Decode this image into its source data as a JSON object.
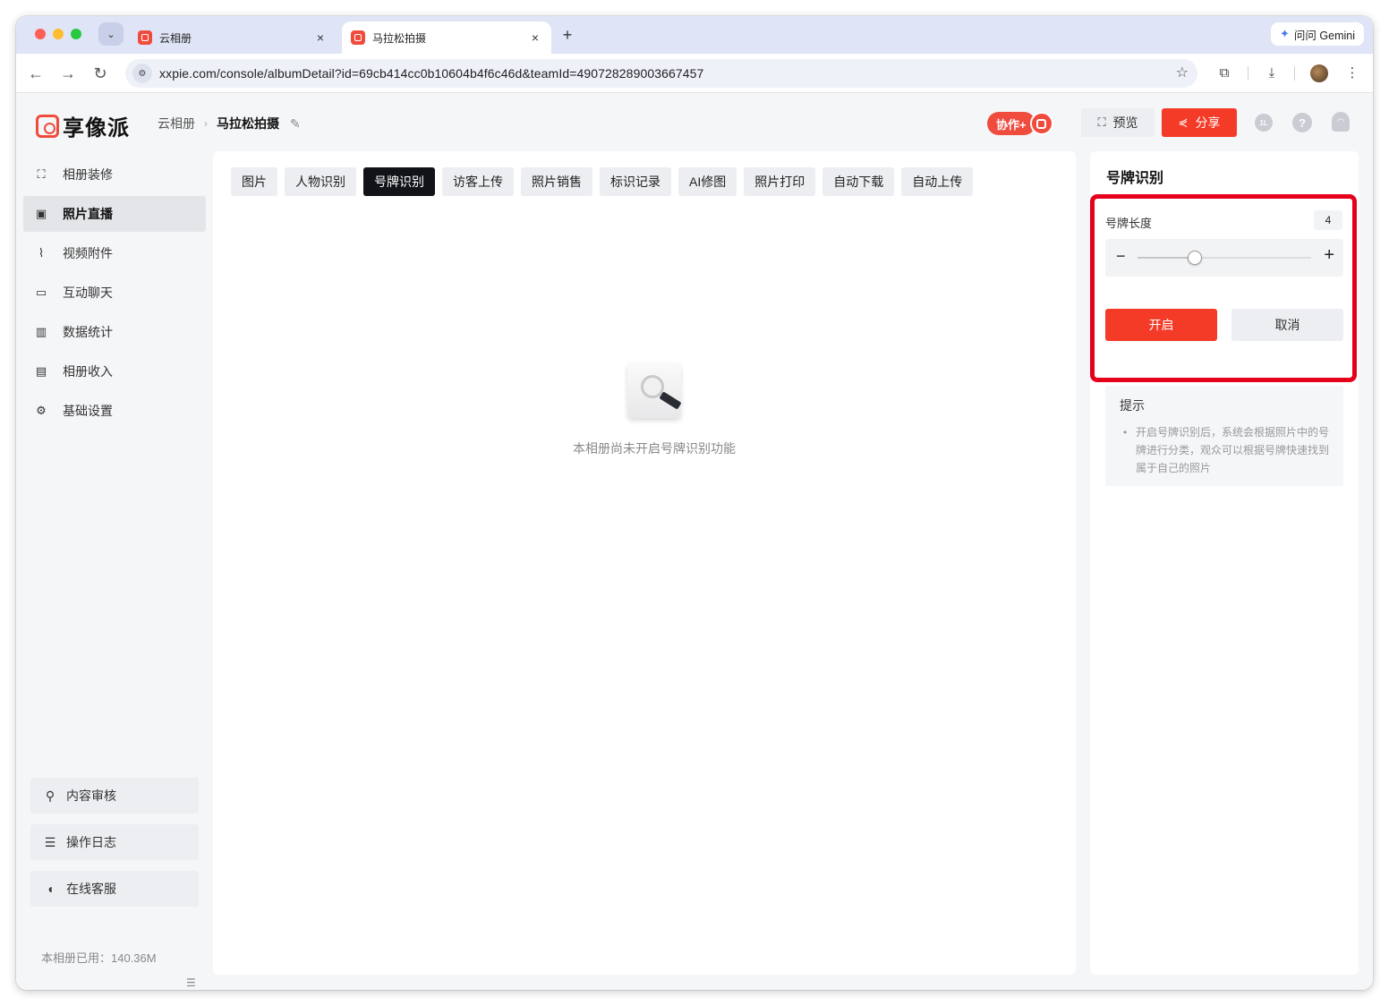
{
  "browser": {
    "tabs": [
      {
        "title": "云相册",
        "close": "×"
      },
      {
        "title": "马拉松拍摄",
        "close": "×"
      }
    ],
    "new_tab": "+",
    "gemini_label": "问问 Gemini",
    "url": "xxpie.com/console/albumDetail?id=69cb414cc0b10604b4f6c46d&teamId=490728289003667457"
  },
  "header": {
    "logo_text": "享像派",
    "breadcrumb": [
      "云相册",
      "马拉松拍摄"
    ],
    "collab_label": "协作+",
    "preview_label": "预览",
    "share_label": "分享",
    "user_badge": "1L"
  },
  "sidebar": {
    "items": [
      {
        "label": "相册装修",
        "icon": "frame-icon"
      },
      {
        "label": "照片直播",
        "icon": "image-icon"
      },
      {
        "label": "视频附件",
        "icon": "paperclip-icon"
      },
      {
        "label": "互动聊天",
        "icon": "chat-icon"
      },
      {
        "label": "数据统计",
        "icon": "chart-icon"
      },
      {
        "label": "相册收入",
        "icon": "wallet-icon"
      },
      {
        "label": "基础设置",
        "icon": "gear-icon"
      }
    ],
    "active_index": 1,
    "bottom": [
      {
        "label": "内容审核",
        "icon": "stamp-icon"
      },
      {
        "label": "操作日志",
        "icon": "log-icon"
      },
      {
        "label": "在线客服",
        "icon": "headset-icon"
      }
    ],
    "usage": "本相册已用：140.36M"
  },
  "main": {
    "tabs": [
      "图片",
      "人物识别",
      "号牌识别",
      "访客上传",
      "照片销售",
      "标识记录",
      "AI修图",
      "照片打印",
      "自动下载",
      "自动上传"
    ],
    "active_tab": "号牌识别",
    "empty_text": "本相册尚未开启号牌识别功能"
  },
  "panel": {
    "title": "号牌识别",
    "length_label": "号牌长度",
    "length_value": "4",
    "slider_fraction": 0.33,
    "minus": "−",
    "plus": "+",
    "enable_label": "开启",
    "cancel_label": "取消",
    "tip_title": "提示",
    "tip_text": "开启号牌识别后，系统会根据照片中的号牌进行分类，观众可以根据号牌快速找到属于自己的照片"
  },
  "colors": {
    "accent": "#f43b28",
    "highlight_border": "#e5001b",
    "active_tab_bg": "#111318"
  }
}
